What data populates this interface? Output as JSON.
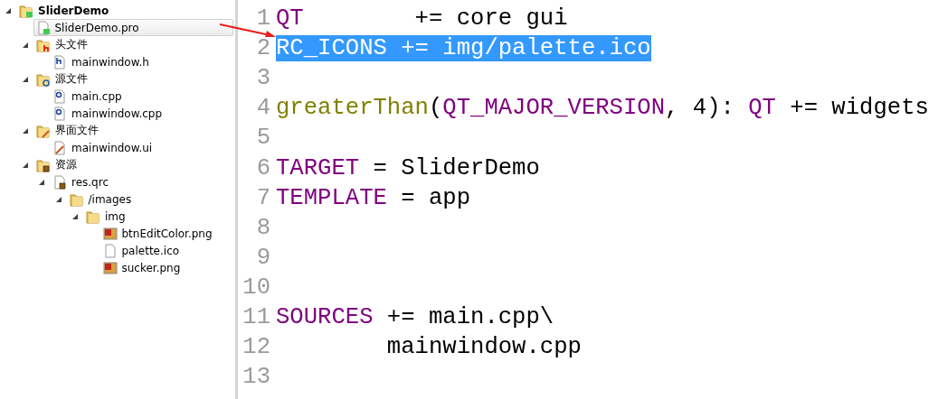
{
  "project_tree": [
    {
      "label": "SliderDemo",
      "kind": "project",
      "expanded": true,
      "selected": false,
      "children": [
        {
          "label": "SliderDemo.pro",
          "kind": "pro",
          "selected": true
        },
        {
          "label": "头文件",
          "kind": "header-group",
          "expanded": true,
          "selected": false,
          "children": [
            {
              "label": "mainwindow.h",
              "kind": "header",
              "selected": false
            }
          ]
        },
        {
          "label": "源文件",
          "kind": "source-group",
          "expanded": true,
          "selected": false,
          "children": [
            {
              "label": "main.cpp",
              "kind": "source",
              "selected": false
            },
            {
              "label": "mainwindow.cpp",
              "kind": "source",
              "selected": false
            }
          ]
        },
        {
          "label": "界面文件",
          "kind": "form-group",
          "expanded": true,
          "selected": false,
          "children": [
            {
              "label": "mainwindow.ui",
              "kind": "form",
              "selected": false
            }
          ]
        },
        {
          "label": "资源",
          "kind": "resource-group",
          "expanded": true,
          "selected": false,
          "children": [
            {
              "label": "res.qrc",
              "kind": "qrc",
              "expanded": true,
              "selected": false,
              "children": [
                {
                  "label": "/images",
                  "kind": "folder",
                  "expanded": true,
                  "selected": false,
                  "children": [
                    {
                      "label": "img",
                      "kind": "folder",
                      "expanded": true,
                      "selected": false,
                      "children": [
                        {
                          "label": "btnEditColor.png",
                          "kind": "image",
                          "selected": false
                        },
                        {
                          "label": "palette.ico",
                          "kind": "file",
                          "selected": false
                        },
                        {
                          "label": "sucker.png",
                          "kind": "image",
                          "selected": false
                        }
                      ]
                    }
                  ]
                }
              ]
            }
          ]
        }
      ]
    }
  ],
  "editor": {
    "lines": [
      {
        "number": "1",
        "selected": false,
        "tokens": [
          {
            "kind": "keyword",
            "text": "QT"
          },
          {
            "kind": "plain",
            "text": "        += core gui"
          }
        ]
      },
      {
        "number": "2",
        "selected": true,
        "text": "RC_ICONS += img/palette.ico"
      },
      {
        "number": "3",
        "selected": false
      },
      {
        "number": "4",
        "selected": false,
        "tokens": [
          {
            "kind": "function",
            "text": "greaterThan"
          },
          {
            "kind": "plain",
            "text": "("
          },
          {
            "kind": "keyword",
            "text": "QT_MAJOR_VERSION"
          },
          {
            "kind": "plain",
            "text": ", 4): "
          },
          {
            "kind": "keyword",
            "text": "QT"
          },
          {
            "kind": "plain",
            "text": " += widgets"
          }
        ]
      },
      {
        "number": "5",
        "selected": false
      },
      {
        "number": "6",
        "selected": false,
        "tokens": [
          {
            "kind": "keyword",
            "text": "TARGET"
          },
          {
            "kind": "plain",
            "text": " = SliderDemo"
          }
        ]
      },
      {
        "number": "7",
        "selected": false,
        "tokens": [
          {
            "kind": "keyword",
            "text": "TEMPLATE"
          },
          {
            "kind": "plain",
            "text": " = app"
          }
        ]
      },
      {
        "number": "8",
        "selected": false
      },
      {
        "number": "9",
        "selected": false
      },
      {
        "number": "10",
        "selected": false
      },
      {
        "number": "11",
        "selected": false,
        "tokens": [
          {
            "kind": "keyword",
            "text": "SOURCES"
          },
          {
            "kind": "plain",
            "text": " += main.cpp\\"
          }
        ]
      },
      {
        "number": "12",
        "selected": false,
        "tokens": [
          {
            "kind": "plain",
            "text": "        mainwindow.cpp"
          }
        ]
      },
      {
        "number": "13",
        "selected": false
      }
    ]
  }
}
